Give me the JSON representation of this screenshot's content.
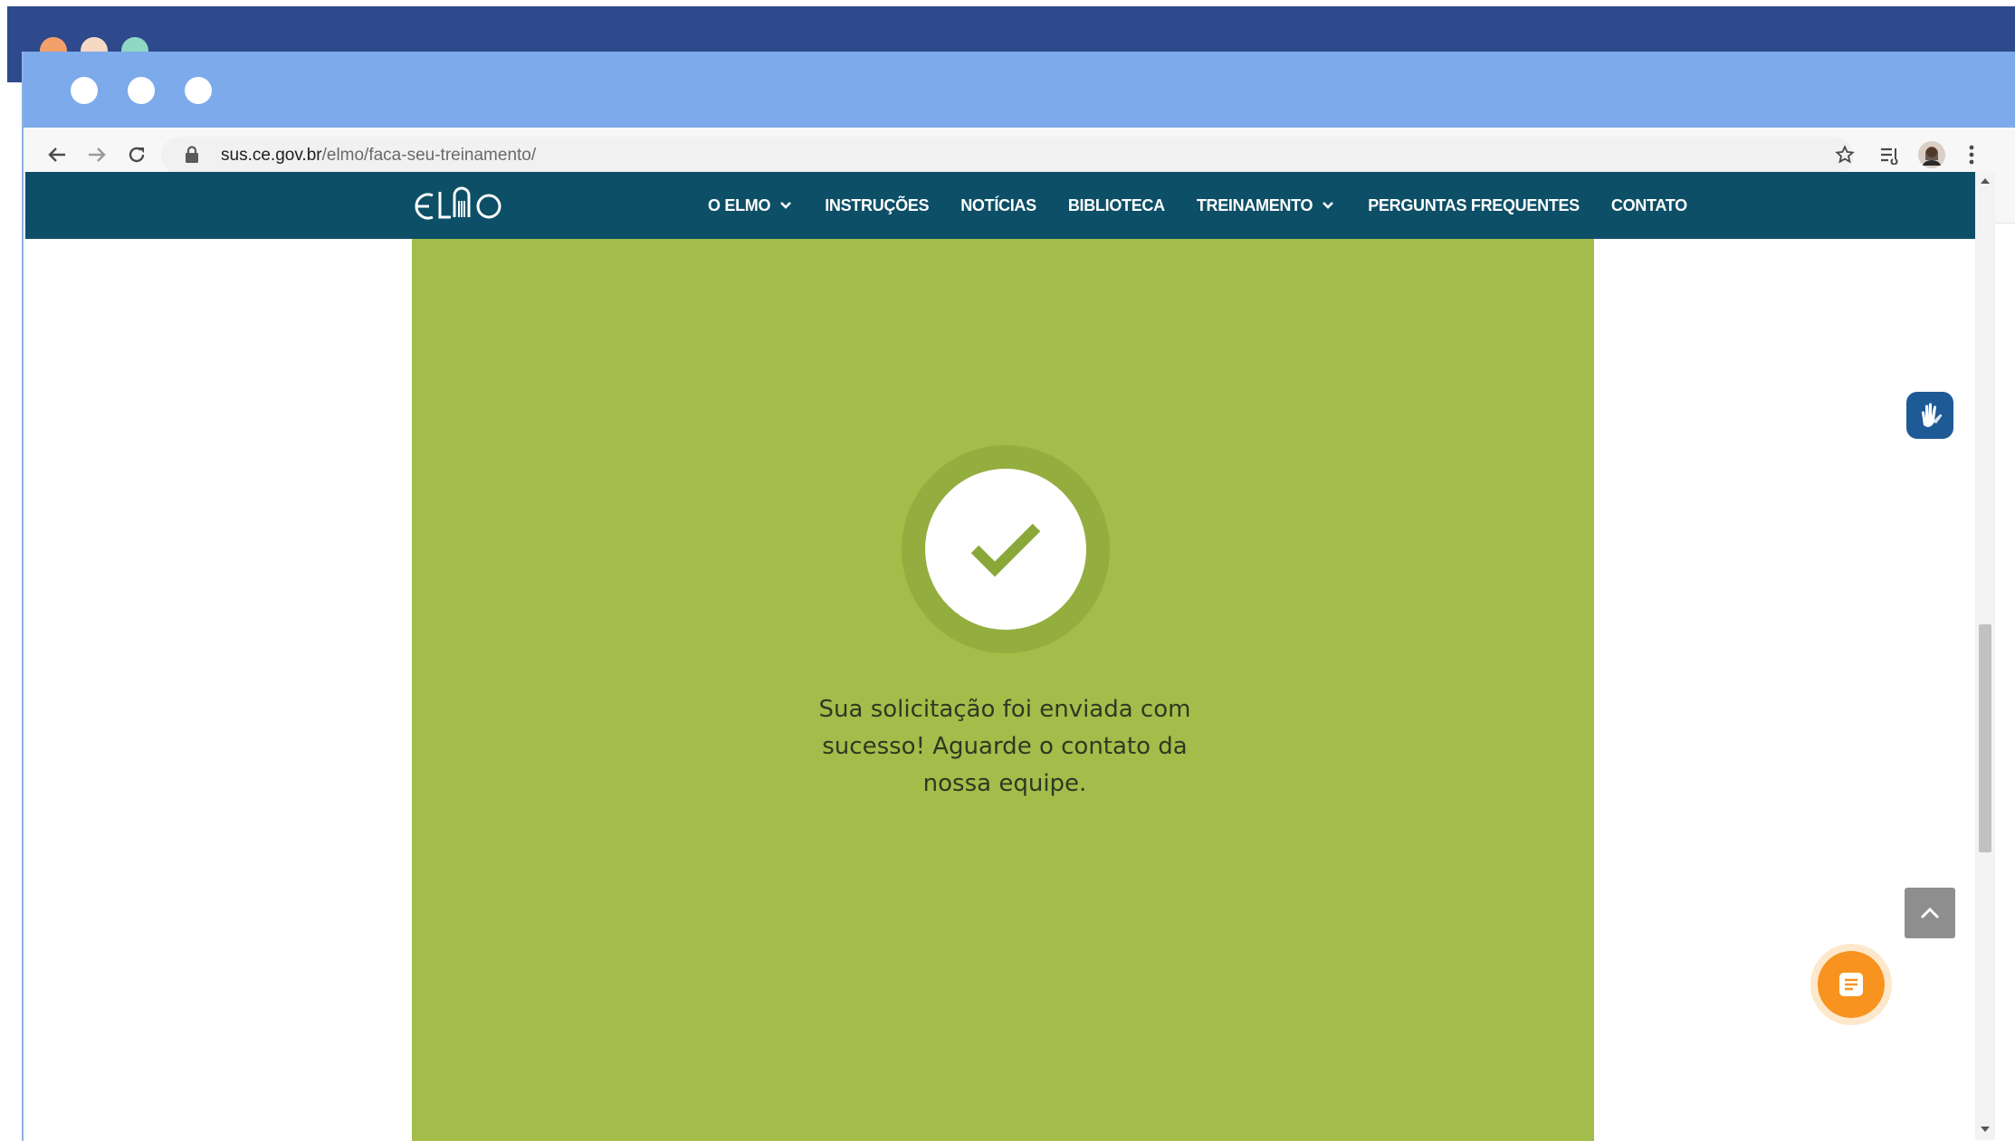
{
  "browser": {
    "url_host": "sus.ce.gov.br",
    "url_path": "/elmo/faca-seu-treinamento/",
    "icons": [
      "back-arrow-icon",
      "forward-arrow-icon",
      "reload-icon",
      "lock-icon",
      "star-icon",
      "reading-list-icon",
      "profile-avatar",
      "more-menu-icon"
    ]
  },
  "site": {
    "logo_text": "ELMO",
    "nav": {
      "o_elmo": "O ELMO",
      "instrucoes": "INSTRUÇÕES",
      "noticias": "NOTÍCIAS",
      "biblioteca": "BIBLIOTECA",
      "treinamento": "TREINAMENTO",
      "perguntas": "PERGUNTAS FREQUENTES",
      "contato": "CONTATO"
    }
  },
  "main": {
    "success_line1": "Sua solicitação foi enviada com",
    "success_line2": "sucesso! Aguarde o contato da",
    "success_line3": "nossa equipe."
  },
  "colors": {
    "header_bg": "#0d4f66",
    "panel_green": "#a3bd4a",
    "check_green": "#8aa83a",
    "chat_orange": "#f7931e",
    "vlibras_blue": "#1e5a96"
  },
  "widgets": {
    "vlibras_icon": "sign-language-hands-icon",
    "back_to_top_icon": "chevron-up-icon",
    "chat_icon": "chat-document-icon"
  }
}
